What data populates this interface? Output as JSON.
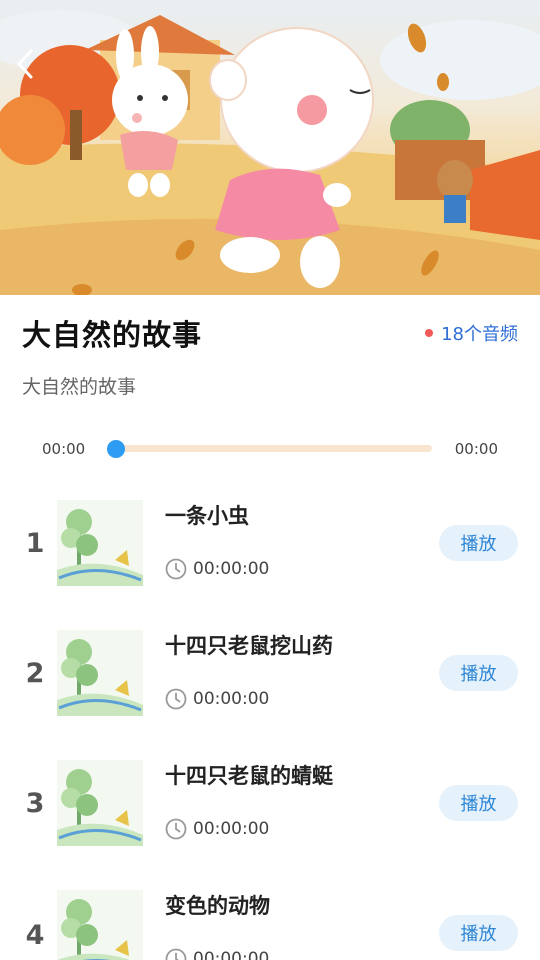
{
  "header": {
    "back_icon": "chevron-left-icon"
  },
  "album": {
    "title": "大自然的故事",
    "audio_count": "18个音频",
    "subtitle": "大自然的故事"
  },
  "player": {
    "current_time": "00:00",
    "total_time": "00:00",
    "progress": 0
  },
  "tracks": [
    {
      "index": "1",
      "name": "一条小虫",
      "duration": "00:00:00",
      "action": "播放"
    },
    {
      "index": "2",
      "name": "十四只老鼠挖山药",
      "duration": "00:00:00",
      "action": "播放"
    },
    {
      "index": "3",
      "name": "十四只老鼠的蜻蜓",
      "duration": "00:00:00",
      "action": "播放"
    },
    {
      "index": "4",
      "name": "变色的动物",
      "duration": "00:00:00",
      "action": "播放"
    }
  ],
  "colors": {
    "accent_blue": "#2e9cf2",
    "count_blue": "#2f6fd6",
    "dot_red": "#f25a5a",
    "play_bg": "#e6f2fb",
    "track_bg": "#f9e4d0"
  }
}
